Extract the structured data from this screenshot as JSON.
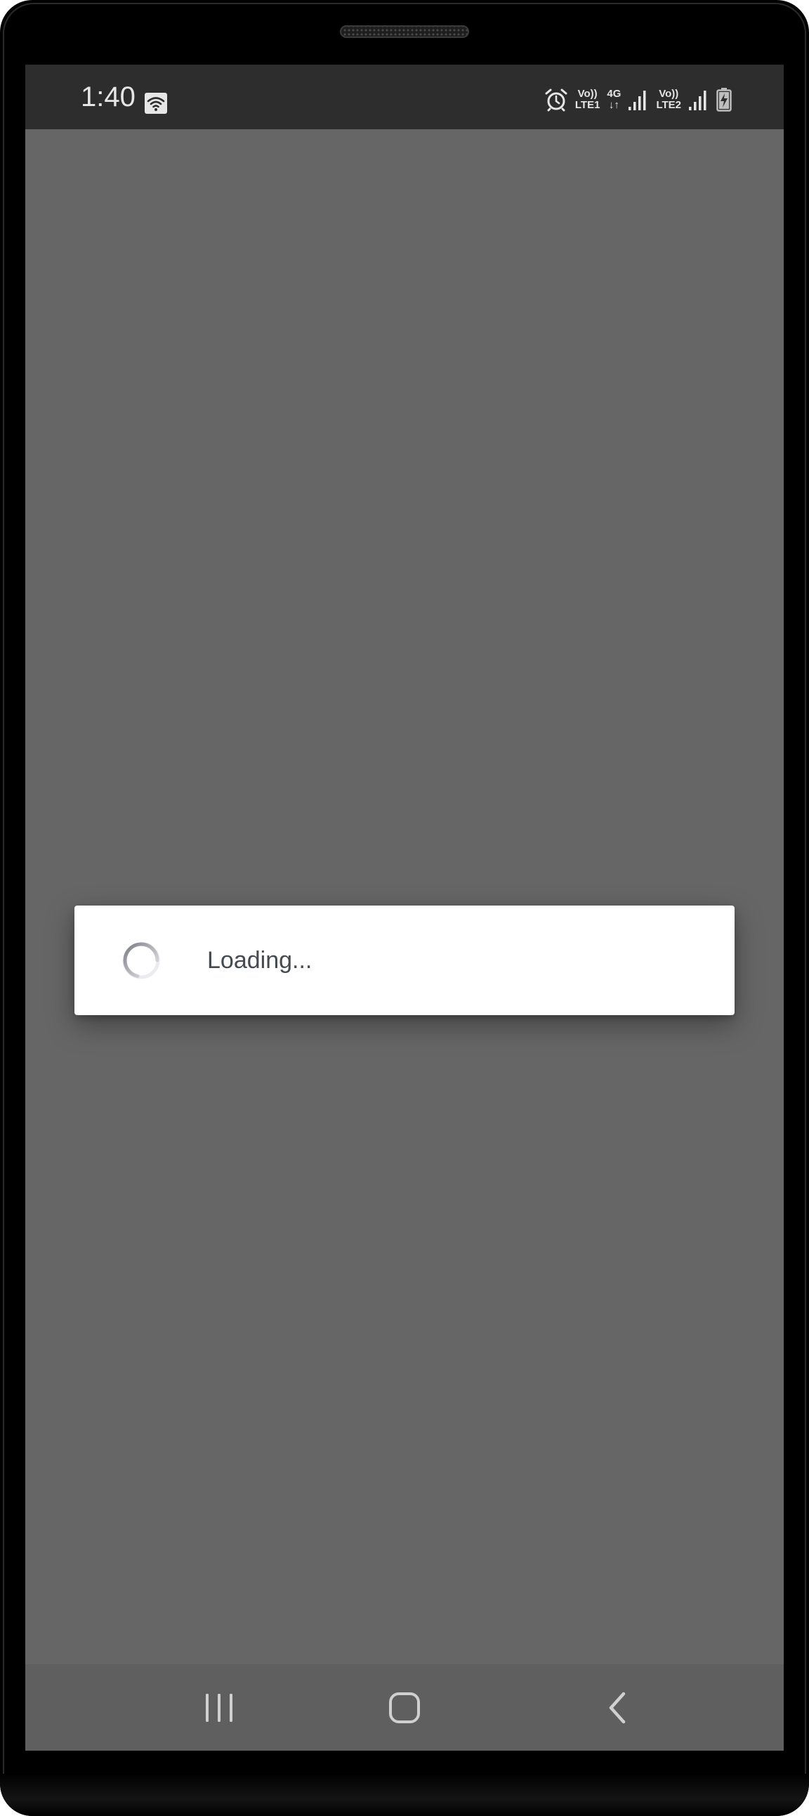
{
  "status_bar": {
    "time": "1:40",
    "sim1_top": "Vo))",
    "sim1_bottom": "LTE1",
    "network_top": "4G",
    "network_bottom": "↓↑",
    "sim2_top": "Vo))",
    "sim2_bottom": "LTE2",
    "icons": [
      "wifi-icon",
      "alarm-icon",
      "signal-icon",
      "battery-charging-icon"
    ]
  },
  "dialog": {
    "message": "Loading..."
  },
  "nav_bar": {
    "icons": [
      "recent-apps-icon",
      "home-icon",
      "back-icon"
    ]
  },
  "colors": {
    "status_bar": "#2d2d2d",
    "screen_dim": "#666666",
    "nav_bar": "#5f5f5f",
    "dialog_bg": "#ffffff",
    "text": "#444a50"
  }
}
